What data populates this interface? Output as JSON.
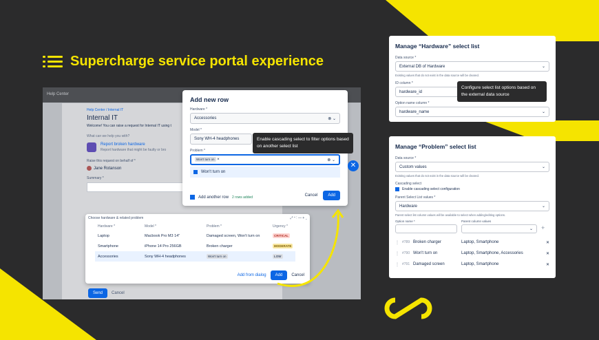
{
  "headline": "Supercharge service portal experience",
  "colors": {
    "accent": "#f5e400",
    "background": "#2b2b2c",
    "primary": "#0c66e4"
  },
  "portal": {
    "top_label": "Help Center",
    "breadcrumb": "Help Center / Internal IT",
    "title": "Internal IT",
    "welcome": "Welcome! You can raise a request for Internal IT using t",
    "help_q": "What can we help you with?",
    "option_title": "Report broken hardware",
    "option_desc": "Report hardware that might be faulty or bro",
    "raise_label": "Raise this request on behalf of *",
    "raise_value": "Jane Rotanson",
    "summary_label": "Summary *",
    "send": "Send",
    "cancel": "Cancel"
  },
  "dialog": {
    "title": "Add new row",
    "hardware_label": "Hardware *",
    "hardware_value": "Accessories",
    "model_label": "Model *",
    "model_value": "Sony WH-4 headphones",
    "problem_label": "Problem *",
    "problem_chip": "Won't turn on",
    "option": "Won't turn on",
    "add_another": "Add another row",
    "rows_added": "2 rows added",
    "cancel": "Cancel",
    "add": "Add"
  },
  "tooltip1": "Enable cascading select to filter options based on another select list",
  "tooltip2": "Configure select list options based on the external data source",
  "table": {
    "title": "Choose hardware & related problem",
    "headers": [
      "Hardware *",
      "Model *",
      "Problem *",
      "Urgency *"
    ],
    "rows": [
      [
        "Laptop",
        "Macbook Pro M3 14\"",
        "Damaged screen, Won't turn on",
        "CRITICAL"
      ],
      [
        "Smartphone",
        "iPhone 14 Pro 256GB",
        "Broken charger",
        "MODERATE"
      ]
    ],
    "edit_row": {
      "hardware": "Accessories",
      "model": "Sony WH-4 headphones",
      "problem": "Won't turn on",
      "urgency": "LOW"
    },
    "add_from_dialog": "Add from dialog",
    "add": "Add",
    "cancel": "Cancel"
  },
  "hardware_panel": {
    "title": "Manage “Hardware” select list",
    "ds_label": "Data source *",
    "ds_value": "External DB of Hardware",
    "ds_help": "Existing values that do not exist in the data source will be cleared.",
    "id_label": "ID column *",
    "id_value": "hardware_id",
    "name_label": "Option name column *",
    "name_value": "hardware_name"
  },
  "problem_panel": {
    "title": "Manage “Problem” select list",
    "ds_label": "Data source *",
    "ds_value": "Custom values",
    "ds_help": "Existing values that do not exist in the data source will be cleared.",
    "cascade_label": "Cascading select",
    "cascade_check": "Enable cascading select configuration",
    "parent_label": "Parent Select List values *",
    "parent_value": "Hardware",
    "parent_help": "Parent select list column values will be available to select when adding/editing options.",
    "opt_name": "Option name *",
    "parent_col": "Parent column values",
    "options": [
      {
        "id": "#789",
        "name": "Broken charger",
        "parents": "Laptop, Smartphone"
      },
      {
        "id": "#790",
        "name": "Won't turn on",
        "parents": "Laptop, Smartphone, Accessories"
      },
      {
        "id": "#791",
        "name": "Damaged screen",
        "parents": "Laptop, Smartphone"
      }
    ]
  }
}
